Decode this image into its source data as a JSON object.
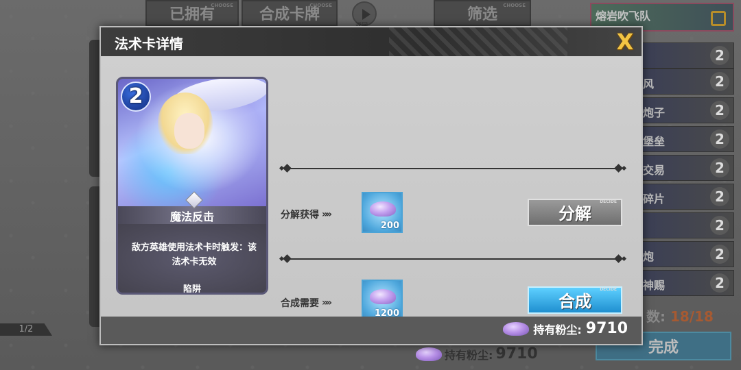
{
  "background": {
    "tabs": {
      "owned": "已拥有",
      "craft": "合成卡牌",
      "filter": "筛选",
      "choose_tag": "CHOOSE",
      "back": "返回"
    },
    "deck": {
      "name": "熔岩吹飞队",
      "rows": [
        {
          "name": "",
          "cost": "2"
        },
        {
          "name": "风",
          "cost": "2"
        },
        {
          "name": "炮子",
          "cost": "2"
        },
        {
          "name": "堡垒",
          "cost": "2"
        },
        {
          "name": "交易",
          "cost": "2"
        },
        {
          "name": "碎片",
          "cost": "2"
        },
        {
          "name": "",
          "cost": "2"
        },
        {
          "name": "炮",
          "cost": "2"
        },
        {
          "name": "神赐",
          "cost": "2"
        }
      ],
      "count_label": "数:",
      "count_value": "18/18",
      "done_label": "完成"
    },
    "page_indicator": "1/2",
    "dust_label": "持有粉尘:",
    "dust_value": "9710"
  },
  "dialog": {
    "title": "法术卡详情",
    "close_label": "X",
    "card": {
      "cost": "2",
      "name": "魔法反击",
      "description": "敌方英雄使用法术卡时触发：该法术卡无效",
      "type": "陷阱"
    },
    "decompose": {
      "label": "分解获得",
      "amount": "200",
      "button": "分解",
      "tag": "DECIDE"
    },
    "craft": {
      "label": "合成需要",
      "amount": "1200",
      "button": "合成",
      "tag": "DECIDE"
    },
    "footer": {
      "dust_label": "持有粉尘:",
      "dust_value": "9710"
    }
  }
}
